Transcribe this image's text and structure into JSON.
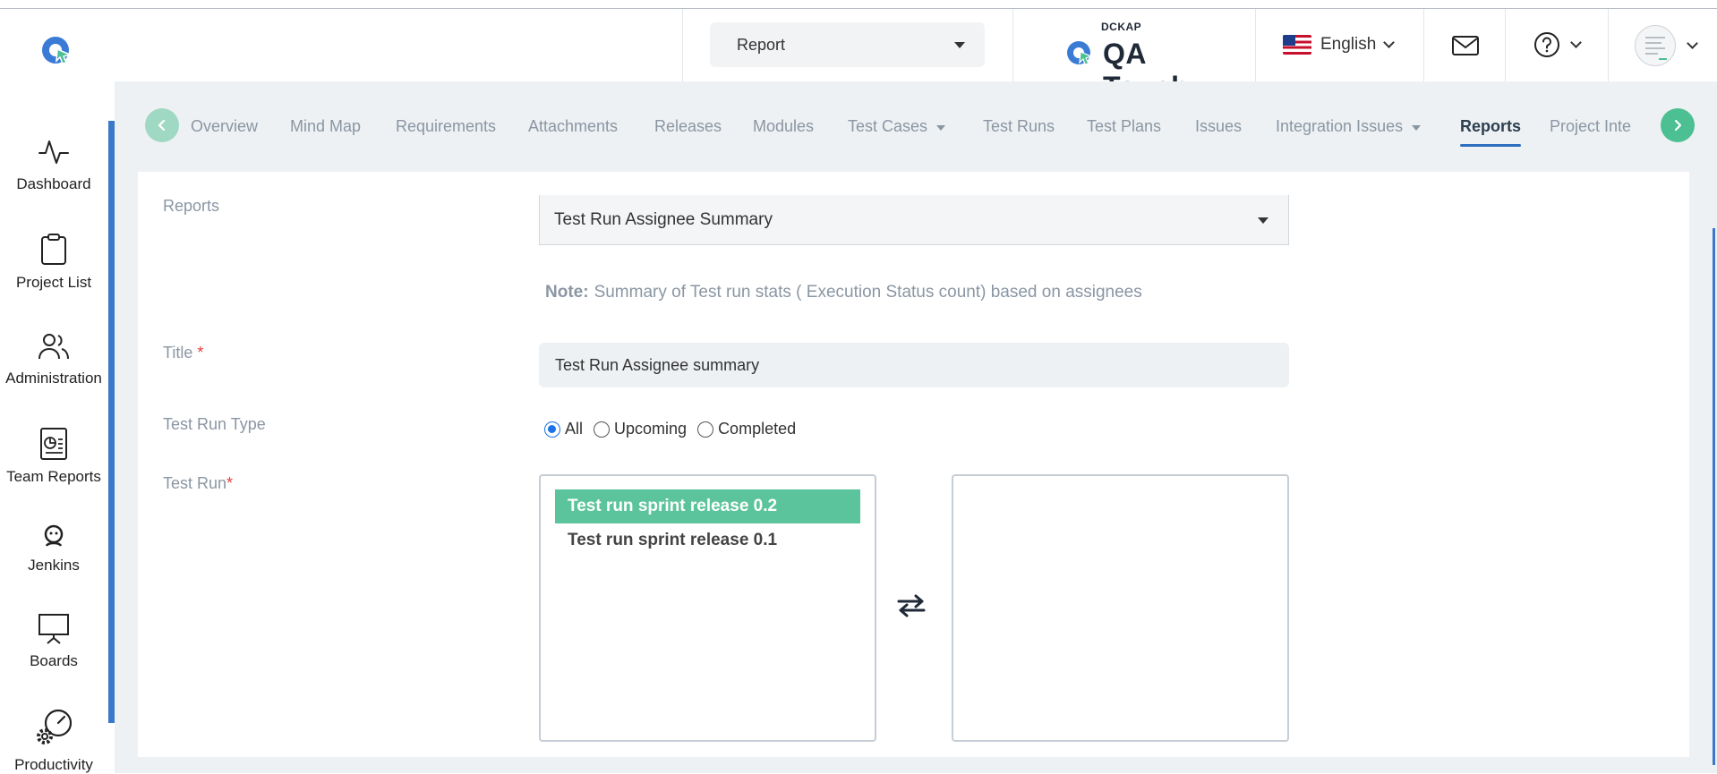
{
  "header": {
    "project_select": "Report",
    "brand_small": "DCKAP",
    "brand_name": "QA Touch",
    "language": "English"
  },
  "sidebar": {
    "items": [
      {
        "label": "Dashboard"
      },
      {
        "label": "Project List"
      },
      {
        "label": "Administration"
      },
      {
        "label": "Team Reports"
      },
      {
        "label": "Jenkins"
      },
      {
        "label": "Boards"
      },
      {
        "label": "Productivity"
      }
    ]
  },
  "tabs": [
    {
      "label": "Overview"
    },
    {
      "label": "Mind Map"
    },
    {
      "label": "Requirements"
    },
    {
      "label": "Attachments"
    },
    {
      "label": "Releases"
    },
    {
      "label": "Modules"
    },
    {
      "label": "Test Cases"
    },
    {
      "label": "Test Runs"
    },
    {
      "label": "Test Plans"
    },
    {
      "label": "Issues"
    },
    {
      "label": "Integration Issues"
    },
    {
      "label": "Reports"
    },
    {
      "label": "Project Inte"
    }
  ],
  "form": {
    "reports_label": "Reports",
    "report_type": "Test Run Assignee Summary",
    "note_label": "Note:",
    "note_text": "Summary of Test run stats ( Execution Status count) based on assignees",
    "title_label": "Title",
    "required_mark": "*",
    "title_value": "Test Run Assignee summary",
    "run_type_label": "Test Run Type",
    "run_type_options": [
      "All",
      "Upcoming",
      "Completed"
    ],
    "run_type_selected": "All",
    "test_run_label": "Test Run",
    "available_runs": [
      "Test run sprint release 0.2",
      "Test run sprint release 0.1"
    ],
    "selected_runs": []
  },
  "colors": {
    "accent_green": "#5cc49c",
    "sidebar_accent": "#3a79c9",
    "active_tab_underline": "#2f6fbf"
  }
}
